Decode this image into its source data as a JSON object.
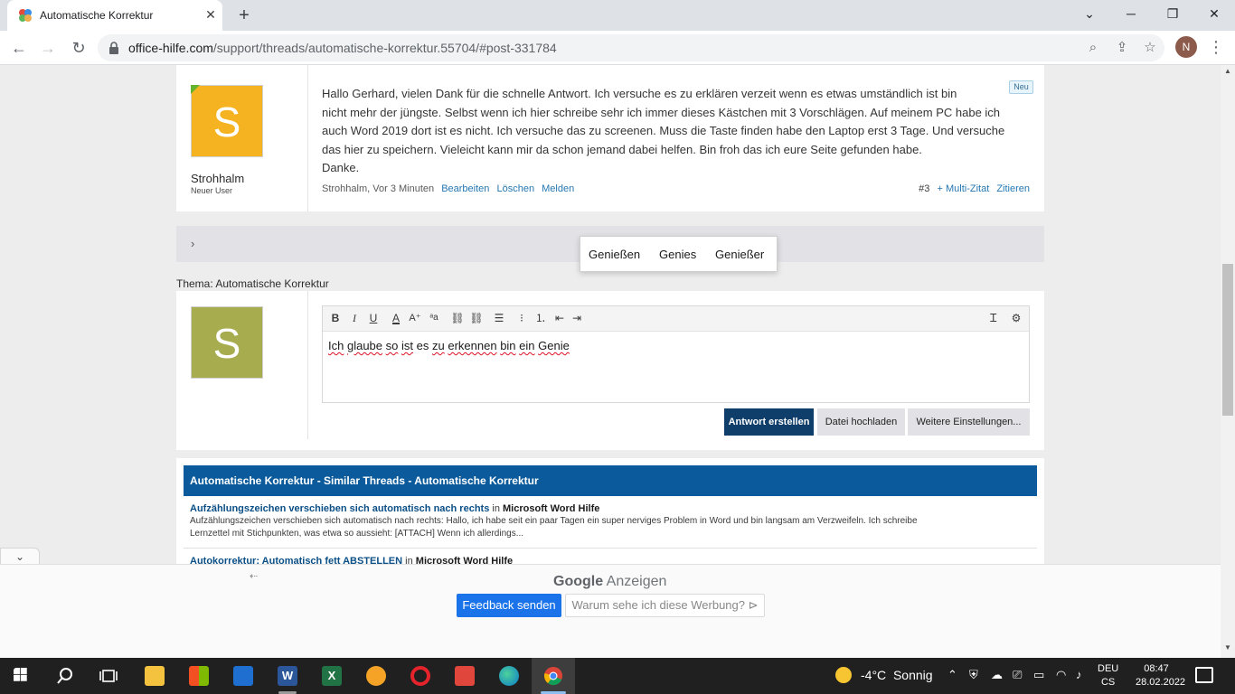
{
  "browser": {
    "tab_title": "Automatische Korrektur",
    "new_tab": "+",
    "url_host": "office-hilfe.com",
    "url_path": "/support/threads/automatische-korrektur.55704/#post-331784",
    "profile_initial": "N",
    "controls": {
      "minimize": "─",
      "restore": "❐",
      "close": "✕",
      "tablist": "⌄"
    }
  },
  "post": {
    "avatar_letter": "S",
    "avatar_color": "#f6b321",
    "user_name": "Strohhalm",
    "user_title": "Neuer User",
    "badge": "Neu",
    "body_lines": [
      "Hallo Gerhard, vielen Dank für die schnelle Antwort. Ich versuche es zu erklären verzeit wenn es etwas umständlich ist bin",
      "nicht mehr der jüngste. Selbst wenn ich hier schreibe sehr ich immer dieses Kästchen mit 3 Vorschlägen. Auf meinem PC habe ich",
      "auch Word 2019 dort ist es nicht. Ich versuche das zu screenen. Muss die Taste finden habe den Laptop erst 3 Tage. Und versuche",
      "das hier zu speichern. Vieleicht kann mir da schon jemand dabei helfen. Bin froh das ich eure Seite gefunden habe.",
      "Danke."
    ],
    "meta": "Strohhalm, Vor 3 Minuten",
    "actions": [
      "Bearbeiten",
      "Löschen",
      "Melden"
    ],
    "number": "#3",
    "multi_quote": "+ Multi-Zitat",
    "quote": "Zitieren"
  },
  "collapsed_chevron": "›",
  "thread_label": "Thema: Automatische Korrektur",
  "reply": {
    "avatar_letter": "S",
    "avatar_color": "#a7ac4e",
    "editor_words": [
      "Ich",
      "glaube",
      "so",
      "ist",
      "es",
      "zu",
      "erkennen",
      "bin",
      "ein",
      "Genie"
    ],
    "suggestions": [
      "Genießen",
      "Genies",
      "Genießer"
    ],
    "toolbar": {
      "bold": "B",
      "italic": "I",
      "underline": "U",
      "color": "A",
      "size": "A⁺",
      "style": "ᵃa"
    },
    "buttons": {
      "submit": "Antwort erstellen",
      "upload": "Datei hochladen",
      "more": "Weitere Einstellungen..."
    }
  },
  "similar": {
    "header": "Automatische Korrektur - Similar Threads - Automatische Korrektur",
    "items": [
      {
        "title": "Aufzählungszeichen verschieben sich automatisch nach rechts",
        "in": "in",
        "forum": "Microsoft Word Hilfe",
        "snippet_lines": [
          "Aufzählungszeichen verschieben sich automatisch nach rechts: Hallo, ich habe seit ein paar Tagen ein super nerviges Problem in Word und bin langsam am Verzweifeln. Ich schreibe",
          "Lernzettel mit Stichpunkten, was etwa so aussieht: [ATTACH] Wenn ich allerdings..."
        ]
      },
      {
        "title": "Autokorrektur: Automatisch fett ABSTELLEN",
        "in": "in",
        "forum": "Microsoft Word Hilfe"
      }
    ]
  },
  "ad": {
    "google": "Google",
    "anzeigen": "Anzeigen",
    "feedback": "Feedback senden",
    "why": "Warum sehe ich diese Werbung? ⊳",
    "collapse": "⌄",
    "back": "⇠"
  },
  "taskbar": {
    "weather_temp": "-4°C",
    "weather_text": "Sonnig",
    "lang_top": "DEU",
    "lang_bottom": "CS",
    "time": "08:47",
    "date": "28.02.2022",
    "apps": [
      "start",
      "search",
      "task-view",
      "file-explorer",
      "store",
      "mail",
      "word",
      "excel",
      "chat",
      "opera",
      "gmail",
      "edge",
      "chrome"
    ]
  },
  "colors": {
    "accent_blue": "#0b5b9c",
    "link_blue": "#2577b1",
    "button_dark": "#0e3e69",
    "google_blue": "#1a73e8"
  }
}
